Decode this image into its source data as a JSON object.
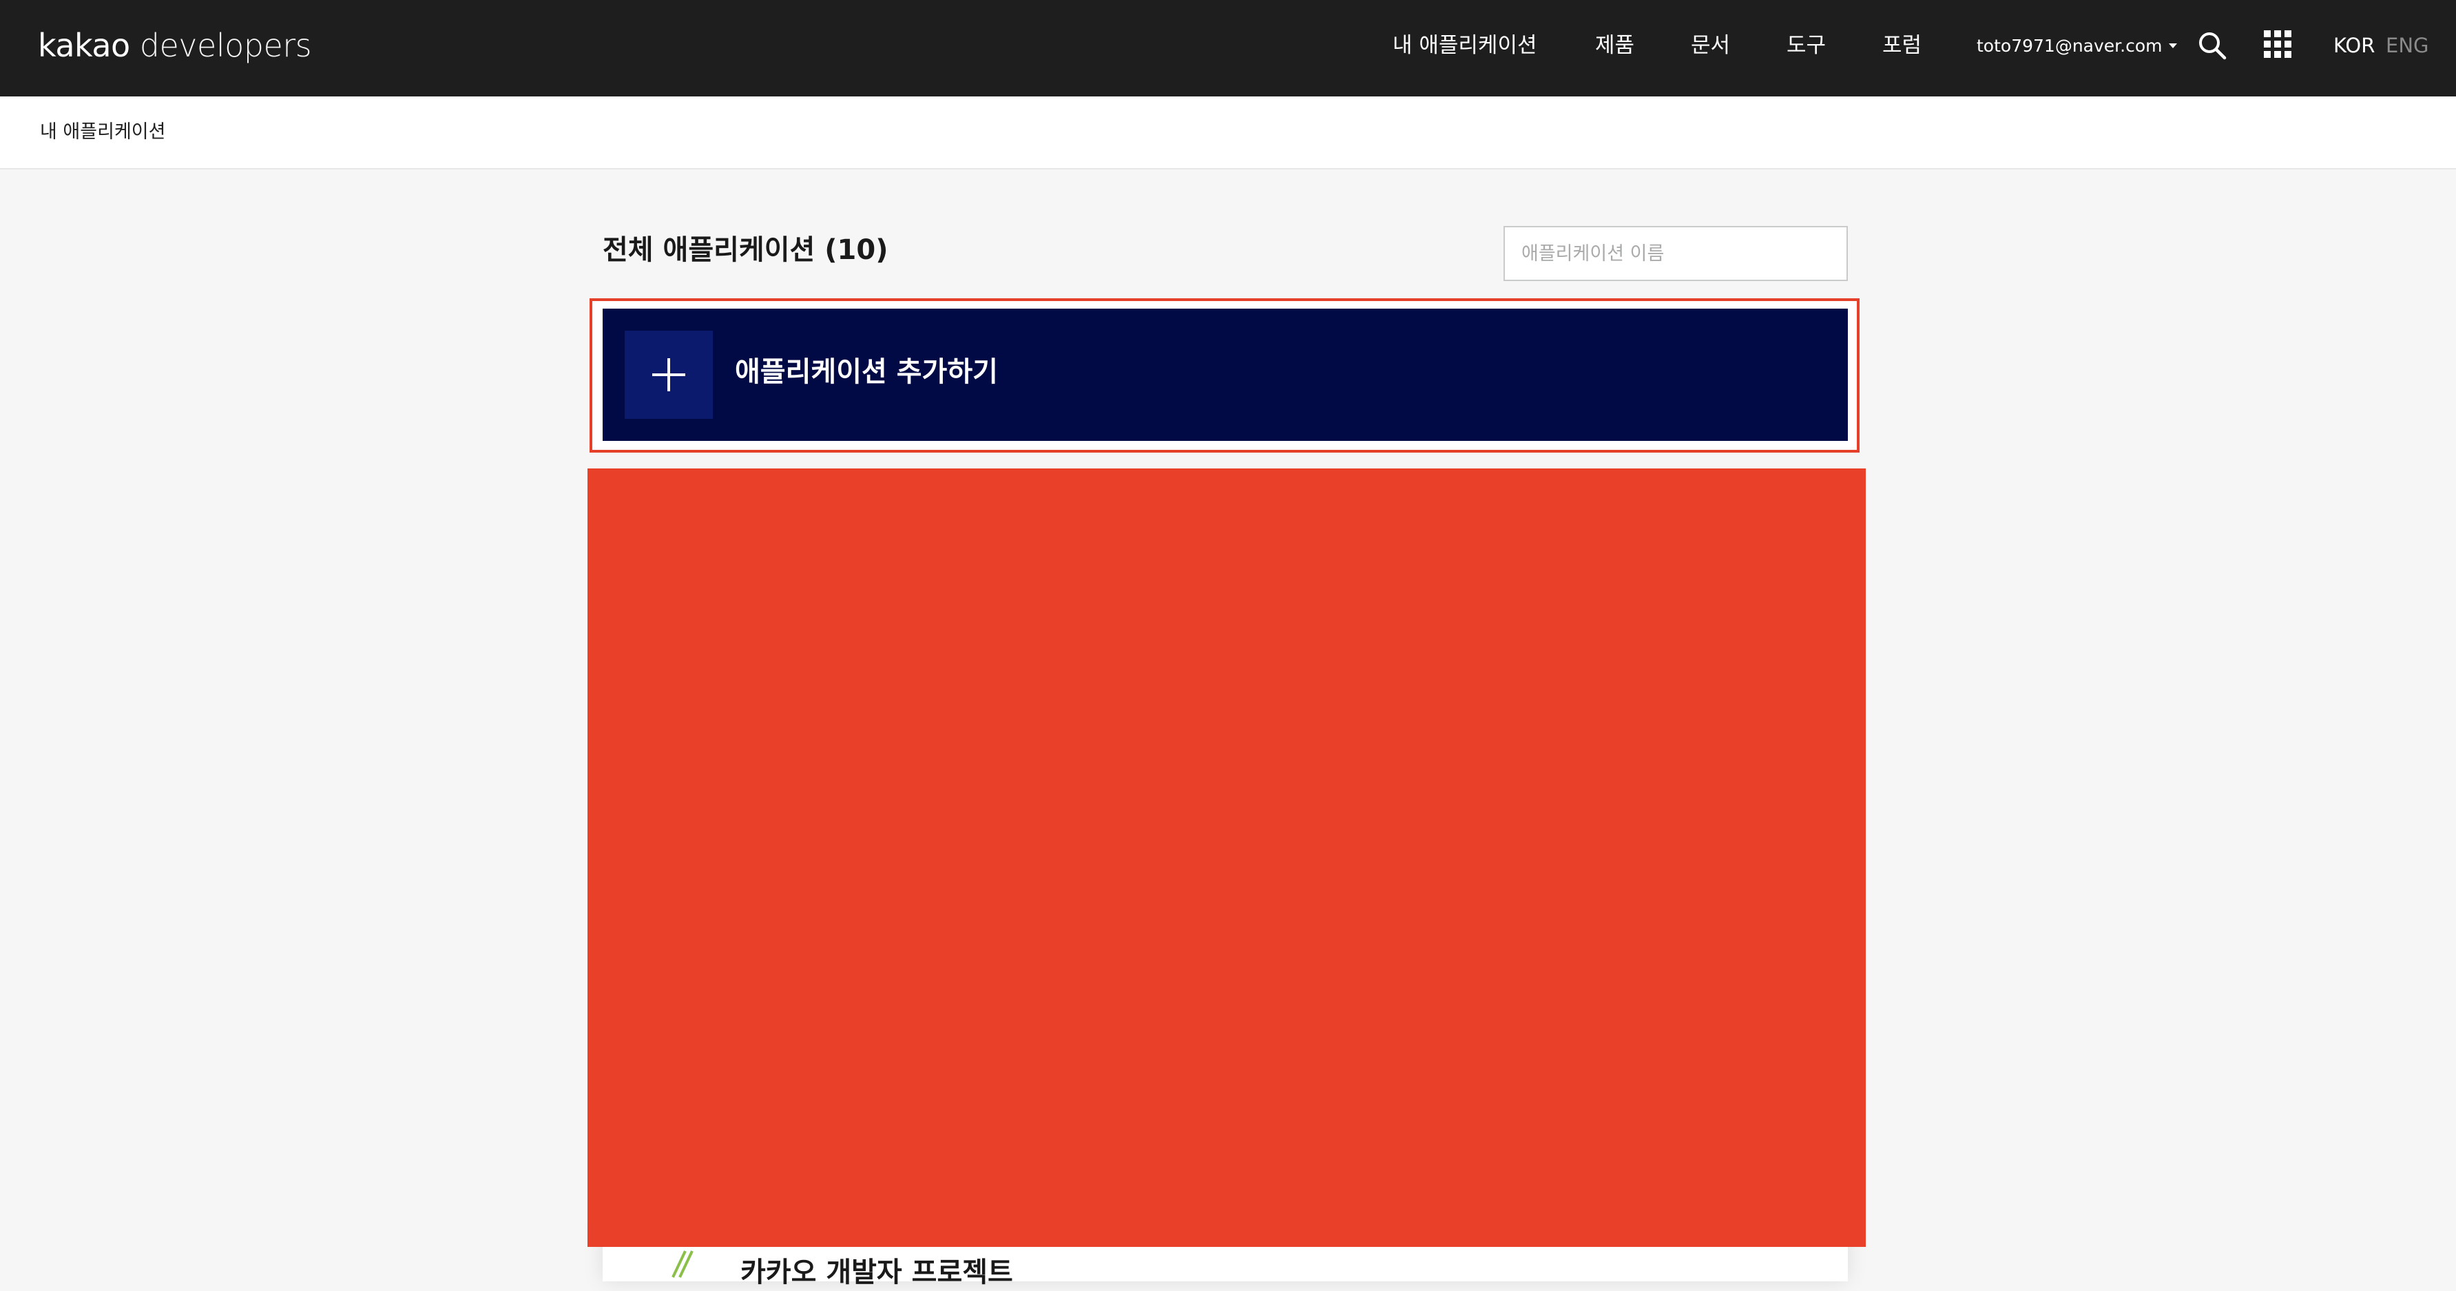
{
  "header": {
    "logo_brand": "kakao",
    "logo_suffix": " developers",
    "nav": [
      {
        "label": "내 애플리케이션"
      },
      {
        "label": "제품"
      },
      {
        "label": "문서"
      },
      {
        "label": "도구"
      },
      {
        "label": "포럼"
      }
    ],
    "account_email": "toto7971@naver.com",
    "icons": [
      "search-icon",
      "apps-grid-icon",
      "caret-down-icon"
    ],
    "languages": [
      {
        "label": "KOR",
        "active": true
      },
      {
        "label": "ENG",
        "active": false
      }
    ]
  },
  "breadcrumb": {
    "current": "내 애플리케이션"
  },
  "main": {
    "title": "전체 애플리케이션 (10)",
    "search_placeholder": "애플리케이션 이름",
    "add_button_label": "애플리케이션 추가하기",
    "partial_card_text": "카카오 개발자 프로젝트"
  },
  "colors": {
    "header_bg": "#1e1e1e",
    "add_button_bg": "#020a45",
    "add_button_icon_bg": "#0c1a6e",
    "highlight_border": "#e5402a",
    "redaction": "#e94129",
    "page_bg": "#f5f6f5"
  }
}
